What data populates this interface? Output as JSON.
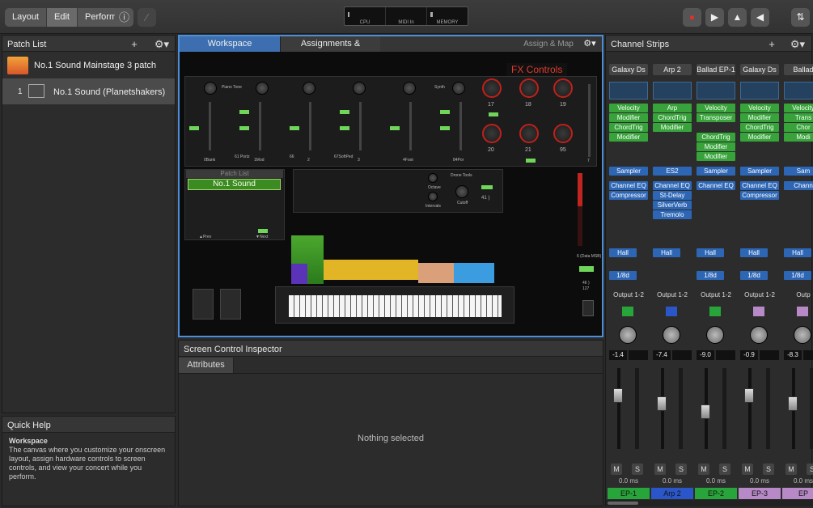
{
  "toolbar": {
    "layout": "Layout",
    "edit": "Edit",
    "perform": "Perform",
    "lcd": [
      "CPU",
      "MIDI In",
      "MEMORY"
    ]
  },
  "patch_list": {
    "title": "Patch List",
    "concert": "No.1 Sound Mainstage 3 patch",
    "patches": [
      {
        "num": "1",
        "name": "No.1 Sound (Planetshakers)"
      }
    ]
  },
  "quick_help": {
    "title": "Quick Help",
    "heading": "Workspace",
    "body": "The canvas where you customize your onscreen layout, assign hardware controls to screen controls, and view your concert while you perform."
  },
  "workspace": {
    "tabs": [
      "Workspace",
      "Assignments & Mappings"
    ],
    "assign_map": "Assign & Map",
    "fx_title": "FX Controls",
    "fx_values": [
      "17",
      "18",
      "19",
      "20",
      "21",
      "95"
    ],
    "knob_labels": [
      "Piano Tone",
      "Synth"
    ],
    "fader_labels": [
      "0Bank",
      "61 Portz",
      "1Mod",
      "66",
      "2",
      "67SoftPed",
      "3",
      "4Foot",
      "84Por",
      "7"
    ],
    "patch_list_label": "Patch List",
    "patch_name": "No.1 Sound",
    "prev": "▲Prev",
    "next": "▼Next",
    "drone_label": "Drone Tools",
    "octave": "Octave",
    "intervals": "Intervals",
    "cutoff": "Cutoff",
    "cutoff_val": "41 )",
    "data_msb": "6 (Data MSB)",
    "data_val": "46 )",
    "data_val2": "127"
  },
  "inspector": {
    "title": "Screen Control Inspector",
    "tab": "Attributes",
    "empty": "Nothing selected"
  },
  "channel_strips": {
    "title": "Channel Strips",
    "strips": [
      {
        "name": "Galaxy Ds",
        "midi": [
          "Velocity",
          "Modifier",
          "ChordTrig",
          "Modifier"
        ],
        "inst": "Sampler",
        "fx": [
          "Channel EQ",
          "Compressor"
        ],
        "send1": "Hall",
        "send2": "1/8d",
        "out": "Output 1-2",
        "vol": "-1.4",
        "label": "EP-1",
        "color": "#28a53a"
      },
      {
        "name": "Arp 2",
        "midi": [
          "Arp",
          "ChordTrig",
          "Modifier"
        ],
        "inst": "ES2",
        "fx": [
          "Channel EQ",
          "St-Delay",
          "SilverVerb",
          "Tremolo"
        ],
        "send1": "Hall",
        "send2": "",
        "out": "Output 1-2",
        "vol": "-7.4",
        "label": "Arp 2",
        "color": "#2b56c9"
      },
      {
        "name": "Ballad EP-1",
        "midi": [
          "Velocity",
          "Transposer",
          "",
          "ChordTrig",
          "Modifier",
          "Modifier"
        ],
        "inst": "Sampler",
        "fx": [
          "Channel EQ"
        ],
        "send1": "Hall",
        "send2": "1/8d",
        "out": "Output 1-2",
        "vol": "-9.0",
        "label": "EP-2",
        "color": "#28a53a"
      },
      {
        "name": "Galaxy Ds",
        "midi": [
          "Velocity",
          "Modifier",
          "ChordTrig",
          "Modifier"
        ],
        "inst": "Sampler",
        "fx": [
          "Channel EQ",
          "Compressor"
        ],
        "send1": "Hall",
        "send2": "1/8d",
        "out": "Output 1-2",
        "vol": "-0.9",
        "label": "EP-3",
        "color": "#b789c7"
      },
      {
        "name": "Ballad",
        "midi": [
          "Velocity",
          "Trans",
          "Chor",
          "Modi"
        ],
        "inst": "Sam",
        "fx": [
          "Chann"
        ],
        "send1": "Hall",
        "send2": "1/8d",
        "out": "Outp",
        "vol": "-8.3",
        "label": "EP",
        "color": "#b789c7"
      }
    ],
    "peak": "0.0 ms",
    "mute": "M",
    "solo": "S"
  }
}
